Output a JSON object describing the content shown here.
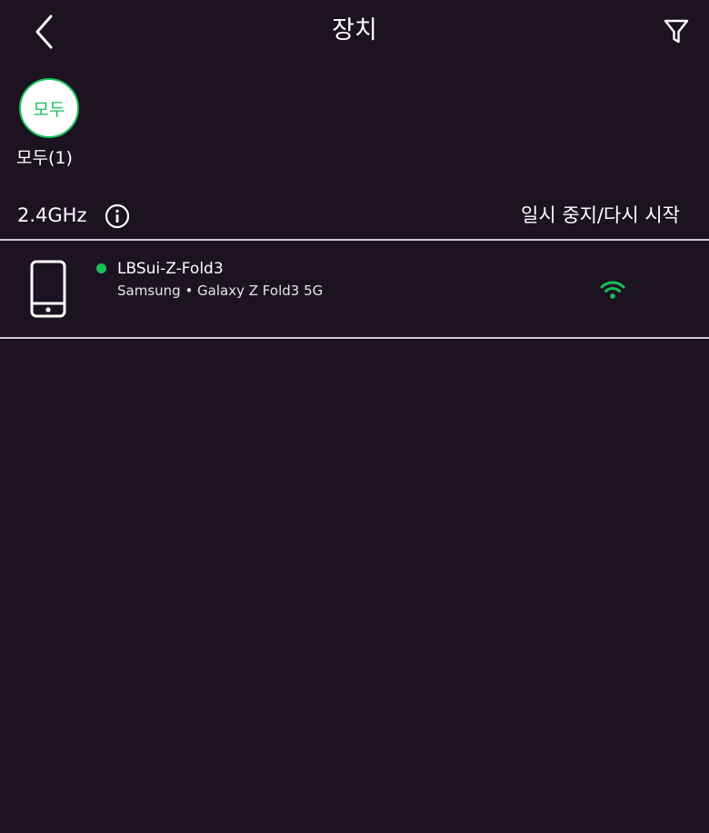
{
  "header": {
    "title": "장치",
    "back_icon": "chevron-left-icon",
    "filter_icon": "filter-icon"
  },
  "filter": {
    "chip_label": "모두",
    "chip_caption": "모두(1)"
  },
  "band": {
    "label": "2.4GHz",
    "info_icon": "info-icon",
    "action_label": "일시 중지/다시 시작"
  },
  "devices": [
    {
      "name": "LBSui-Z-Fold3",
      "model": "Samsung • Galaxy Z Fold3 5G",
      "icon": "smartphone-icon",
      "status_icon": "wifi-icon"
    }
  ],
  "colors": {
    "background": "#1c1222",
    "accent": "#18c05a",
    "divider": "#cfcad4"
  }
}
